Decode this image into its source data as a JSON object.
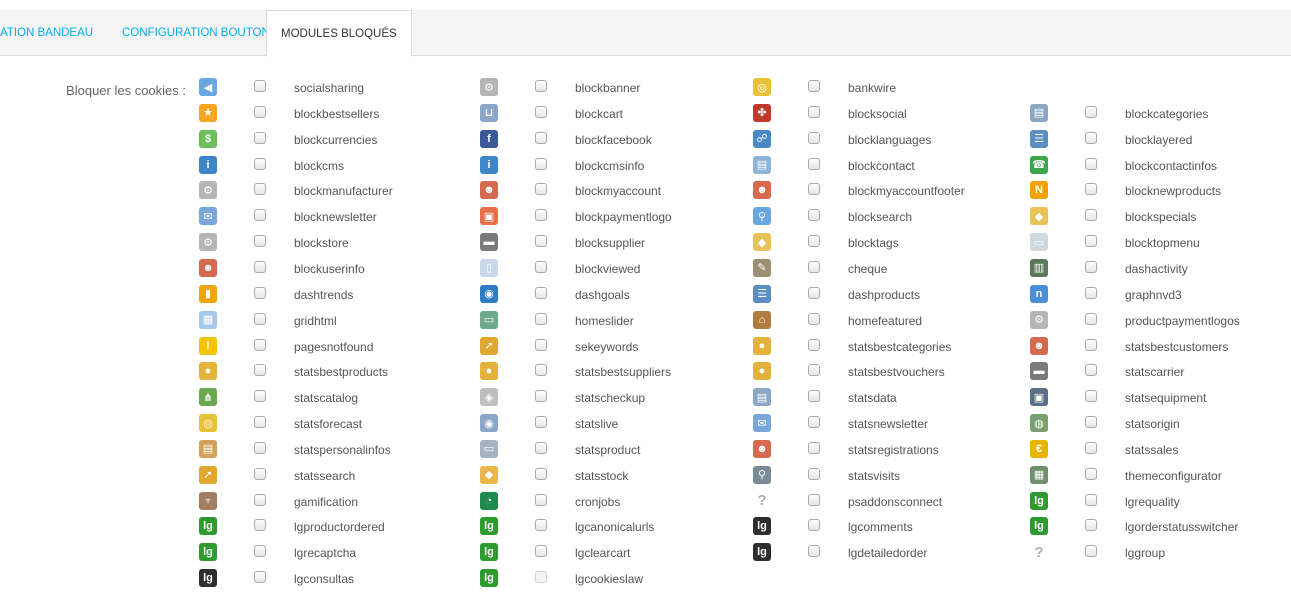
{
  "tabs": [
    {
      "label": "ATION BANDEAU",
      "active": false
    },
    {
      "label": "CONFIGURATION BOUTONS",
      "active": false
    },
    {
      "label": "MODULES BLOQUÉS",
      "active": true
    }
  ],
  "field_label": "Bloquer les cookies :",
  "columns": [
    [
      {
        "name": "socialsharing",
        "icon": "share-icon"
      },
      {
        "name": "blockbestsellers",
        "icon": "star-icon"
      },
      {
        "name": "blockcurrencies",
        "icon": "money-icon"
      },
      {
        "name": "blockcms",
        "icon": "info-icon"
      },
      {
        "name": "blockmanufacturer",
        "icon": "gear-icon"
      },
      {
        "name": "blocknewsletter",
        "icon": "envelope-icon"
      },
      {
        "name": "blockstore",
        "icon": "gear-icon"
      },
      {
        "name": "blockuserinfo",
        "icon": "user-icon"
      },
      {
        "name": "dashtrends",
        "icon": "bar-chart-icon"
      },
      {
        "name": "gridhtml",
        "icon": "table-icon"
      },
      {
        "name": "pagesnotfound",
        "icon": "warning-icon"
      },
      {
        "name": "statsbestproducts",
        "icon": "medal-icon"
      },
      {
        "name": "statscatalog",
        "icon": "sitemap-icon"
      },
      {
        "name": "statsforecast",
        "icon": "coins-icon"
      },
      {
        "name": "statspersonalinfos",
        "icon": "user-card-icon"
      },
      {
        "name": "statssearch",
        "icon": "search-arrow-icon"
      },
      {
        "name": "gamification",
        "icon": "trophy-icon"
      },
      {
        "name": "lgproductordered",
        "icon": "lg-icon"
      },
      {
        "name": "lgrecaptcha",
        "icon": "lg-icon"
      },
      {
        "name": "lgconsultas",
        "icon": "lg-dark-icon"
      }
    ],
    [
      {
        "name": "blockbanner",
        "icon": "gear-icon"
      },
      {
        "name": "blockcart",
        "icon": "cart-icon"
      },
      {
        "name": "blockfacebook",
        "icon": "facebook-icon"
      },
      {
        "name": "blockcmsinfo",
        "icon": "info-icon"
      },
      {
        "name": "blockmyaccount",
        "icon": "user-icon"
      },
      {
        "name": "blockpaymentlogo",
        "icon": "payment-icon"
      },
      {
        "name": "blocksupplier",
        "icon": "truck-icon"
      },
      {
        "name": "blockviewed",
        "icon": "document-search-icon"
      },
      {
        "name": "dashgoals",
        "icon": "target-icon"
      },
      {
        "name": "homeslider",
        "icon": "slider-icon"
      },
      {
        "name": "sekeywords",
        "icon": "search-arrow-icon"
      },
      {
        "name": "statsbestsuppliers",
        "icon": "medal-icon"
      },
      {
        "name": "statscheckup",
        "icon": "box-icon"
      },
      {
        "name": "statslive",
        "icon": "eye-icon"
      },
      {
        "name": "statsproduct",
        "icon": "drawer-icon"
      },
      {
        "name": "statsstock",
        "icon": "package-icon"
      },
      {
        "name": "cronjobs",
        "icon": "clock-icon"
      },
      {
        "name": "lgcanonicalurls",
        "icon": "lg-icon"
      },
      {
        "name": "lgclearcart",
        "icon": "lg-icon"
      },
      {
        "name": "lgcookieslaw",
        "icon": "lg-icon"
      }
    ],
    [
      {
        "name": "bankwire",
        "icon": "coins-icon"
      },
      {
        "name": "blocksocial",
        "icon": "social-icon"
      },
      {
        "name": "blocklanguages",
        "icon": "language-icon"
      },
      {
        "name": "blockcontact",
        "icon": "contact-card-icon"
      },
      {
        "name": "blockmyaccountfooter",
        "icon": "user-icon"
      },
      {
        "name": "blocksearch",
        "icon": "magnifier-icon"
      },
      {
        "name": "blocktags",
        "icon": "tag-icon"
      },
      {
        "name": "cheque",
        "icon": "cheque-icon"
      },
      {
        "name": "dashproducts",
        "icon": "list-icon"
      },
      {
        "name": "homefeatured",
        "icon": "home-icon"
      },
      {
        "name": "statsbestcategories",
        "icon": "medal-icon"
      },
      {
        "name": "statsbestvouchers",
        "icon": "medal-icon"
      },
      {
        "name": "statsdata",
        "icon": "document-icon"
      },
      {
        "name": "statsnewsletter",
        "icon": "envelope-icon"
      },
      {
        "name": "statsregistrations",
        "icon": "user-icon"
      },
      {
        "name": "statsvisits",
        "icon": "user-search-icon"
      },
      {
        "name": "psaddonsconnect",
        "icon": "question-icon"
      },
      {
        "name": "lgcomments",
        "icon": "lg-dark-icon"
      },
      {
        "name": "lgdetailedorder",
        "icon": "lg-dark-icon"
      }
    ],
    [
      {
        "name": "blockcategories",
        "icon": "document-icon"
      },
      {
        "name": "blocklayered",
        "icon": "list-icon"
      },
      {
        "name": "blockcontactinfos",
        "icon": "phone-icon"
      },
      {
        "name": "blocknewproducts",
        "icon": "new-badge-icon"
      },
      {
        "name": "blockspecials",
        "icon": "tag-icon"
      },
      {
        "name": "blocktopmenu",
        "icon": "window-icon"
      },
      {
        "name": "dashactivity",
        "icon": "activity-icon"
      },
      {
        "name": "graphnvd3",
        "icon": "graph-icon"
      },
      {
        "name": "productpaymentlogos",
        "icon": "gear-icon"
      },
      {
        "name": "statsbestcustomers",
        "icon": "user-icon"
      },
      {
        "name": "statscarrier",
        "icon": "truck-icon"
      },
      {
        "name": "statsequipment",
        "icon": "tv-icon"
      },
      {
        "name": "statsorigin",
        "icon": "globe-icon"
      },
      {
        "name": "statssales",
        "icon": "euro-icon"
      },
      {
        "name": "themeconfigurator",
        "icon": "theme-icon"
      },
      {
        "name": "lgrequality",
        "icon": "lg-icon"
      },
      {
        "name": "lgorderstatusswitcher",
        "icon": "lg-icon"
      },
      {
        "name": "lggroup",
        "icon": "question-icon"
      }
    ]
  ],
  "icon_glyphs": {
    "share-icon": "◀",
    "star-icon": "★",
    "money-icon": "$",
    "info-icon": "i",
    "gear-icon": "⚙",
    "envelope-icon": "✉",
    "user-icon": "☻",
    "bar-chart-icon": "▮",
    "table-icon": "▦",
    "warning-icon": "!",
    "medal-icon": "●",
    "sitemap-icon": "⋔",
    "coins-icon": "◎",
    "user-card-icon": "▤",
    "search-arrow-icon": "➚",
    "trophy-icon": "♆",
    "lg-icon": "lg",
    "lg-dark-icon": "lg",
    "cart-icon": "⊔",
    "facebook-icon": "f",
    "payment-icon": "▣",
    "truck-icon": "▬",
    "document-search-icon": "▯",
    "target-icon": "◉",
    "slider-icon": "▭",
    "box-icon": "◈",
    "eye-icon": "◉",
    "drawer-icon": "▭",
    "package-icon": "◆",
    "clock-icon": "◔",
    "social-icon": "✤",
    "language-icon": "☍",
    "contact-card-icon": "▤",
    "magnifier-icon": "⚲",
    "tag-icon": "◆",
    "cheque-icon": "✎",
    "list-icon": "☰",
    "home-icon": "⌂",
    "document-icon": "▤",
    "user-search-icon": "⚲",
    "question-icon": "?",
    "phone-icon": "☎",
    "new-badge-icon": "N",
    "window-icon": "▭",
    "activity-icon": "▥",
    "graph-icon": "n",
    "tv-icon": "▣",
    "globe-icon": "◍",
    "euro-icon": "€",
    "theme-icon": "▦"
  },
  "icon_colors": {
    "share-icon": "#6aa7e0",
    "star-icon": "#f6a623",
    "money-icon": "#6cbf5a",
    "info-icon": "#3f86c9",
    "gear-icon": "#b5b5b5",
    "envelope-icon": "#7aa7d8",
    "user-icon": "#d56a4f",
    "bar-chart-icon": "#f0a500",
    "table-icon": "#a9c7e8",
    "warning-icon": "#f3c400",
    "medal-icon": "#e3b23c",
    "sitemap-icon": "#6aa84f",
    "coins-icon": "#e8c33a",
    "user-card-icon": "#d4a15a",
    "search-arrow-icon": "#e0a830",
    "trophy-icon": "#a08060",
    "lg-icon": "#2e9b2e",
    "lg-dark-icon": "#2e2e2e",
    "cart-icon": "#8aa6c8",
    "facebook-icon": "#3b5998",
    "payment-icon": "#e86f4b",
    "truck-icon": "#7a7a7a",
    "document-search-icon": "#c9d8ea",
    "target-icon": "#2d7cc4",
    "slider-icon": "#6fa88a",
    "box-icon": "#bfbfbf",
    "eye-icon": "#8aa6c8",
    "drawer-icon": "#a6b2bf",
    "package-icon": "#e9b74a",
    "clock-icon": "#1e8a4c",
    "social-icon": "#c0392b",
    "language-icon": "#4a89c8",
    "contact-card-icon": "#8fb3d9",
    "magnifier-icon": "#6aa7e0",
    "tag-icon": "#e7c35a",
    "cheque-icon": "#9b8f75",
    "list-icon": "#5b8fc4",
    "home-icon": "#b07b3c",
    "document-icon": "#8ba7c4",
    "user-search-icon": "#7a8a96",
    "question-icon": "#b0b0b0",
    "phone-icon": "#3aa84a",
    "new-badge-icon": "#f2a200",
    "window-icon": "#cfd8e0",
    "activity-icon": "#5a7a5a",
    "graph-icon": "#4a8fd8",
    "tv-icon": "#5a6f84",
    "globe-icon": "#7aa070",
    "euro-icon": "#e9b400",
    "theme-icon": "#6f8f6f"
  },
  "last_item_disabled": "lgcookieslaw"
}
